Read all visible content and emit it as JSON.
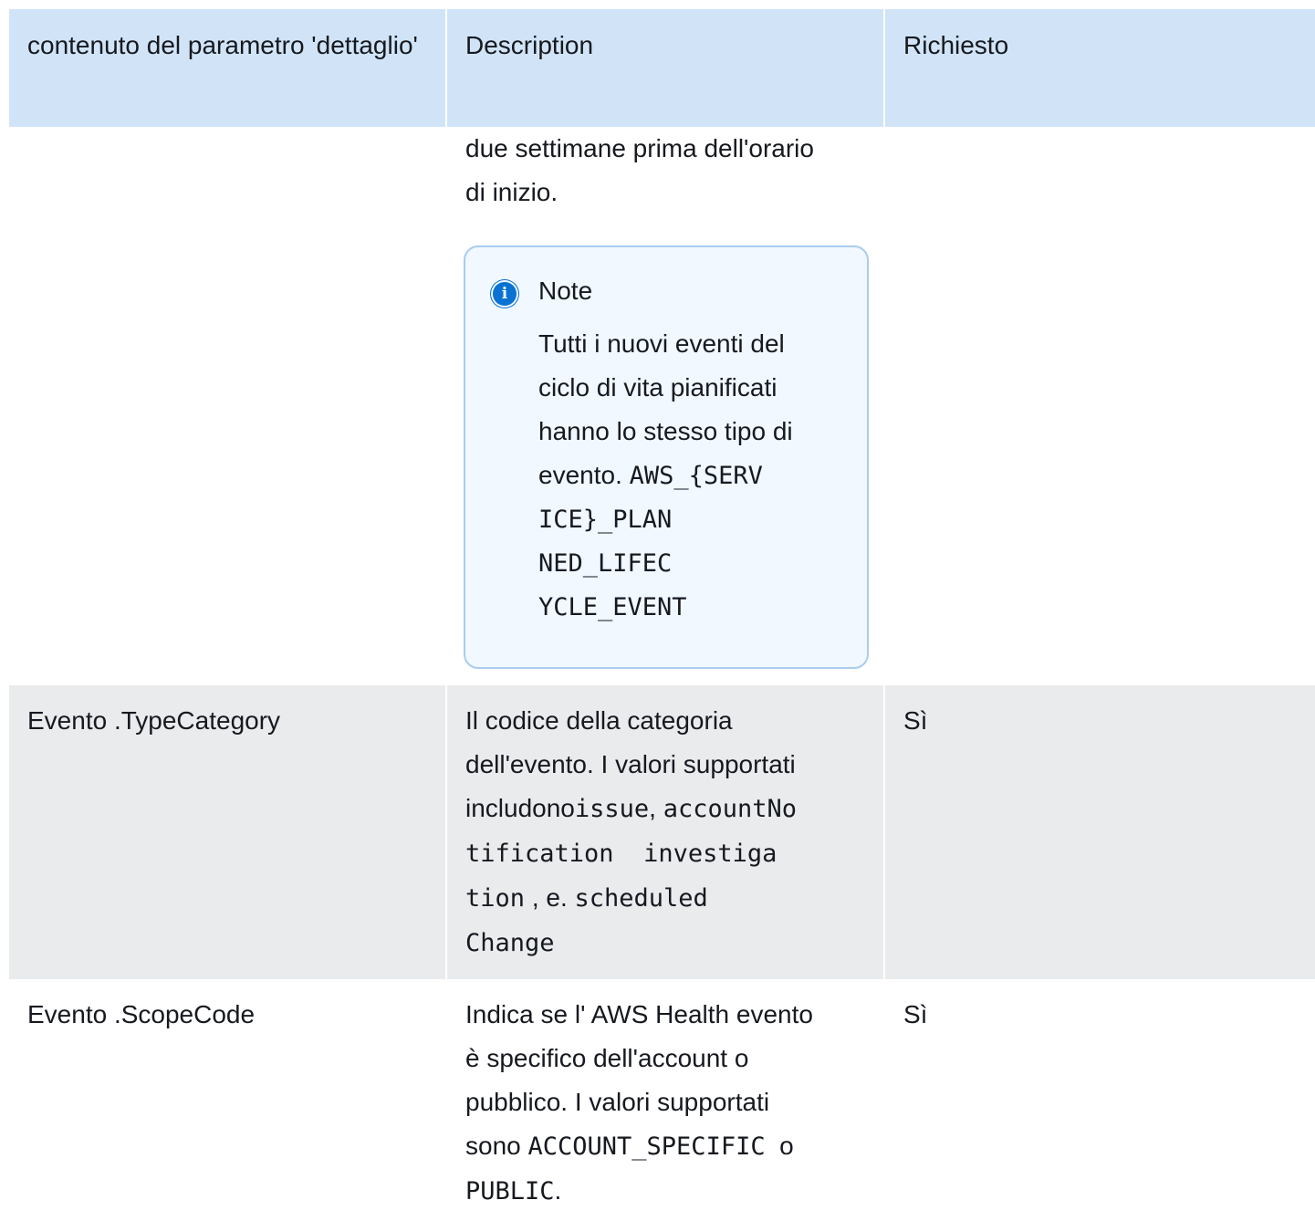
{
  "header": {
    "col1": "contenuto del parametro 'dettaglio'",
    "col2": "Description",
    "col3": "Richiesto"
  },
  "row0": {
    "desc_line1": "due settimane prima dell'orario",
    "desc_line2": "di inizio.",
    "note": {
      "icon": "info-icon",
      "title": "Note",
      "body_lines": [
        "Tutti i nuovi eventi del",
        "ciclo di vita pianificati",
        "hanno lo stesso tipo di",
        "evento."
      ],
      "code_lines": [
        "AWS_{SERV",
        "ICE}_PLAN",
        "NED_LIFEC",
        "YCLE_EVENT"
      ]
    }
  },
  "row1": {
    "name": "Evento .TypeCategory",
    "desc_lines": [
      "Il codice della categoria",
      "dell'evento. I valori supportati",
      "includono"
    ],
    "code": {
      "issue": "issue",
      "sep1": ",",
      "acc1": "accountNo",
      "acc2": "tification",
      "inv1": "investiga",
      "inv2": "tion",
      "sep2": ", e.",
      "sch1": "scheduled",
      "sch2": "Change"
    },
    "required": "Sì"
  },
  "row2": {
    "name": "Evento .ScopeCode",
    "desc_lines": [
      "Indica se l' AWS Health evento",
      "è specifico dell'account o",
      "pubblico. I valori supportati",
      "sono"
    ],
    "code1": "ACCOUNT_SPECIFIC",
    "mid": "o",
    "code2": "PUBLIC",
    "end": ".",
    "required": "Sì"
  }
}
